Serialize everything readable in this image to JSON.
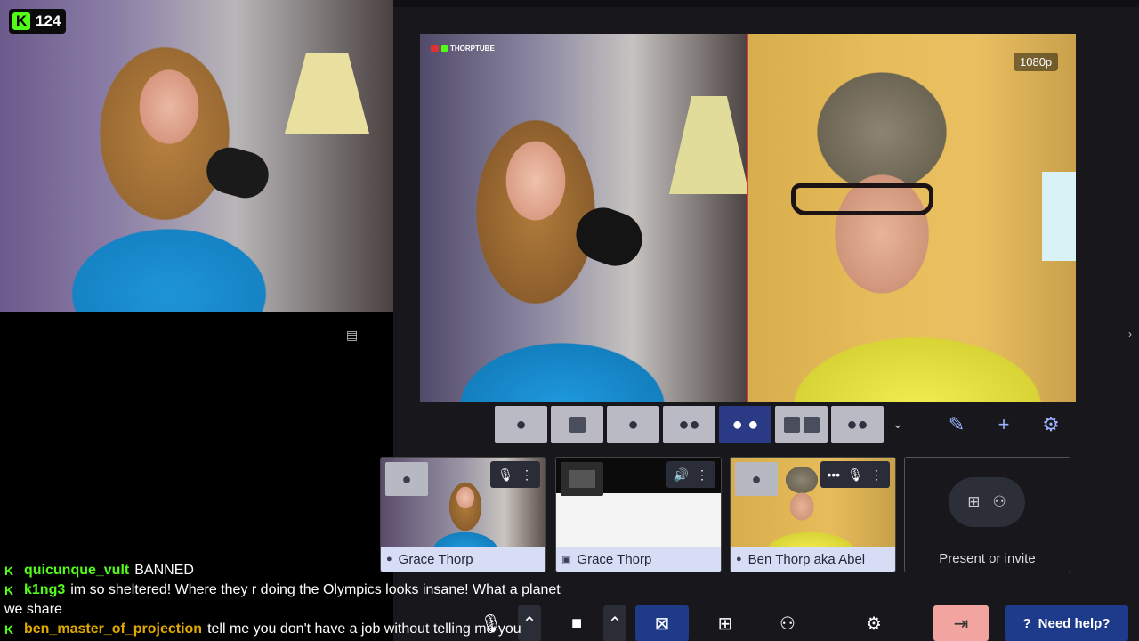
{
  "overlay": {
    "viewer_count": "124",
    "kick_logo": "K"
  },
  "stage": {
    "channel_tag": "THORPTUBE",
    "resolution": "1080p"
  },
  "layouts": [
    {
      "name": "single"
    },
    {
      "name": "single-with-screen"
    },
    {
      "name": "solo-pip"
    },
    {
      "name": "group"
    },
    {
      "name": "split-two",
      "active": true
    },
    {
      "name": "split-panel"
    },
    {
      "name": "grid"
    }
  ],
  "tools": {
    "edit_icon": "pencil-icon",
    "add_icon": "plus-icon",
    "settings_icon": "gear-icon"
  },
  "guests": [
    {
      "name": "Grace Thorp",
      "type": "camera"
    },
    {
      "name": "Grace Thorp",
      "type": "screen"
    },
    {
      "name": "Ben Thorp aka Abel",
      "type": "camera"
    }
  ],
  "present": {
    "label": "Present or invite"
  },
  "chat": [
    {
      "user": "quicunque_vult",
      "message": "BANNED",
      "color": "#53fc18"
    },
    {
      "user": "k1ng3",
      "message": "im so sheltered! Where they r doing the Olympics looks insane! What a planet we share",
      "color": "#53fc18"
    },
    {
      "user": "ben_master_of_projection",
      "message": "tell me you don't have a job without telling me you",
      "color": "#e0a800"
    }
  ],
  "bottom": {
    "help_label": "Need help?"
  },
  "colors": {
    "kick_green": "#53fc18",
    "active_layout": "#2b3a85",
    "panel_bg": "#17171c",
    "leave_button": "#f2a5a0",
    "help_button": "#1e3a8a"
  }
}
